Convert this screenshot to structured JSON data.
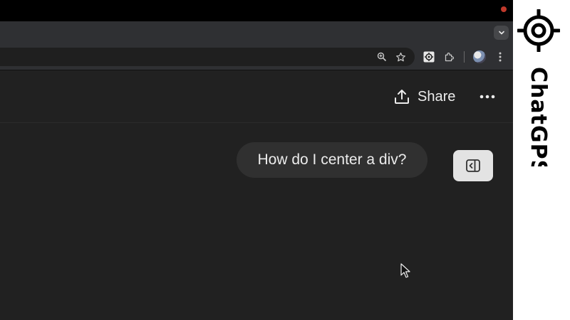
{
  "browser": {
    "toolbar_icons": [
      "zoom-icon",
      "bookmark-star-icon",
      "extension-target-icon",
      "extensions-puzzle-icon",
      "profile-avatar",
      "browser-menu-icon"
    ]
  },
  "chat": {
    "share_label": "Share",
    "user_message": "How do I center a div?"
  },
  "brand": {
    "name": "ChatGPS"
  },
  "colors": {
    "background": "#212121",
    "bubble": "#303030",
    "text": "#ececec",
    "brand_panel": "#ffffff"
  }
}
